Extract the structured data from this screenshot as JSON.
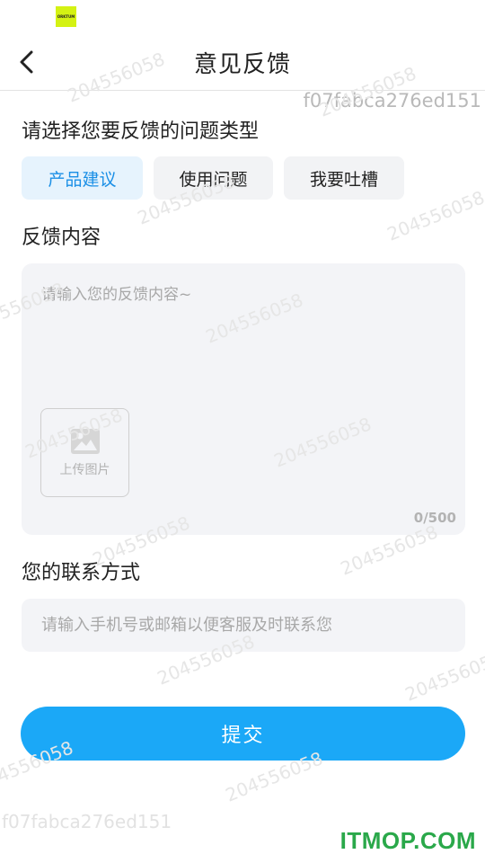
{
  "status_bar": {
    "logo_text": "ORKTUM"
  },
  "header": {
    "title": "意见反馈"
  },
  "device_id": "f07fabca276ed151",
  "watermark_text": "204556058",
  "feedback_type": {
    "label": "请选择您要反馈的问题类型",
    "options": [
      {
        "label": "产品建议",
        "selected": true
      },
      {
        "label": "使用问题",
        "selected": false
      },
      {
        "label": "我要吐槽",
        "selected": false
      }
    ]
  },
  "content": {
    "label": "反馈内容",
    "placeholder": "请输入您的反馈内容~",
    "upload_label": "上传图片",
    "char_count": "0/500"
  },
  "contact": {
    "label": "您的联系方式",
    "placeholder": "请输入手机号或邮箱以便客服及时联系您"
  },
  "submit_label": "提交",
  "brand_watermark": "ITMOP.COM",
  "colors": {
    "accent": "#1ba8f7",
    "selected_tab_bg": "#e6f3fd",
    "selected_tab_text": "#1a8fe6",
    "field_bg": "#f3f4f7",
    "brand_watermark": "#2aa84a"
  }
}
